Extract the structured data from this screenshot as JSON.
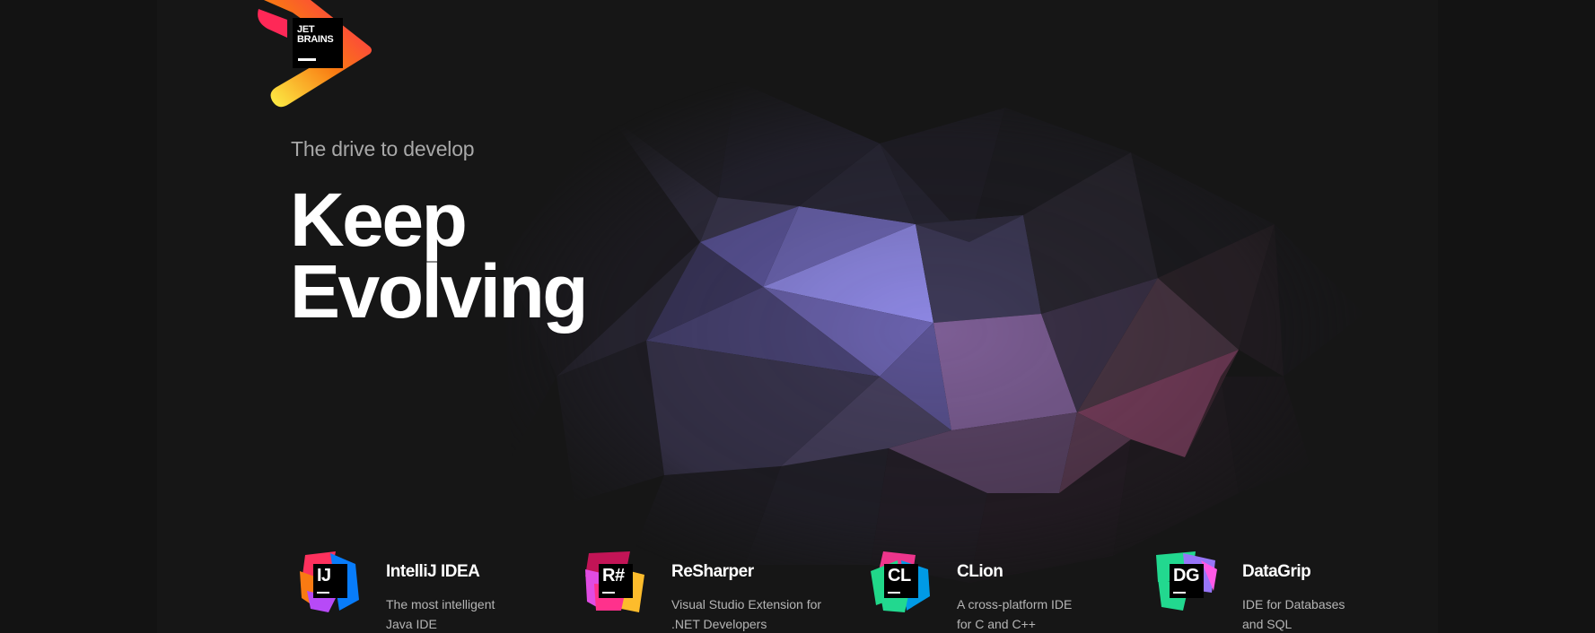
{
  "logo": {
    "line1": "JET",
    "line2": "BRAINS"
  },
  "hero": {
    "tagline": "The drive to develop",
    "headline_line1": "Keep",
    "headline_line2": "Evolving"
  },
  "products": [
    {
      "name": "IntelliJ IDEA",
      "icon_letters": "IJ",
      "icon": "intellij-idea-icon",
      "desc_line1": "The most intelligent",
      "desc_line2": "Java IDE",
      "colors": [
        "#fe315d",
        "#087cfa",
        "#f97a12",
        "#b74af7"
      ]
    },
    {
      "name": "ReSharper",
      "icon_letters": "R#",
      "icon": "resharper-icon",
      "desc_line1": "Visual Studio Extension for",
      "desc_line2": ".NET Developers",
      "colors": [
        "#c21456",
        "#e14ce3",
        "#fdbc2c",
        "#ff318c"
      ]
    },
    {
      "name": "CLion",
      "icon_letters": "CL",
      "icon": "clion-icon",
      "desc_line1": "A cross-platform IDE",
      "desc_line2": "for C and C++",
      "colors": [
        "#21d789",
        "#009ae5",
        "#ed358c",
        "#22d88f"
      ]
    },
    {
      "name": "DataGrip",
      "icon_letters": "DG",
      "icon": "datagrip-icon",
      "desc_line1": "IDE for Databases",
      "desc_line2": "and SQL",
      "colors": [
        "#22d88f",
        "#9775f8",
        "#ff59e6",
        "#22d88f"
      ]
    }
  ],
  "colors": {
    "background": "#161616",
    "logo_gradient": [
      "#fcf84a",
      "#f97a12",
      "#fe2857"
    ],
    "hero_art_purple": "#8c86e0",
    "hero_art_pink": "#c75a8a"
  }
}
